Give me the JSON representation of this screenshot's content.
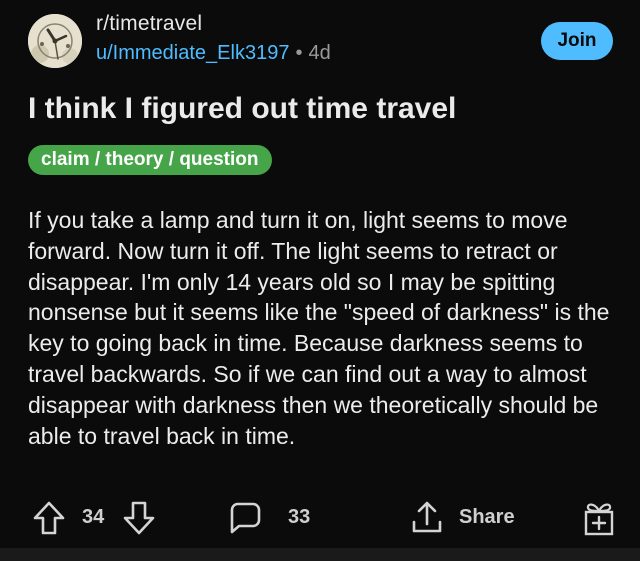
{
  "post": {
    "subreddit": "r/timetravel",
    "username": "u/Immediate_Elk3197",
    "separator": "•",
    "age": "4d",
    "join_label": "Join",
    "title": "I think I figured out time travel",
    "flair": "claim / theory / question",
    "body": "If you take a lamp and turn it on, light seems to move forward. Now turn it off. The light seems to retract or disappear. I'm only 14 years old so I may be spitting nonsense but it seems like the \"speed of darkness\" is the key to going back in time. Because darkness seems to travel backwards. So if we can find out a way to almost disappear with darkness then we theoretically should be able to travel back in time."
  },
  "actions": {
    "votes": "34",
    "comments": "33",
    "share_label": "Share"
  },
  "icons": {
    "upvote": "upvote-arrow-icon",
    "downvote": "downvote-arrow-icon",
    "comment": "comment-bubble-icon",
    "share": "share-upload-icon",
    "award": "award-gift-icon"
  },
  "colors": {
    "background": "#0b0b0b",
    "accent": "#4fbcff",
    "flair": "#47a549",
    "text": "#ececec",
    "muted": "#9a9a9a"
  }
}
